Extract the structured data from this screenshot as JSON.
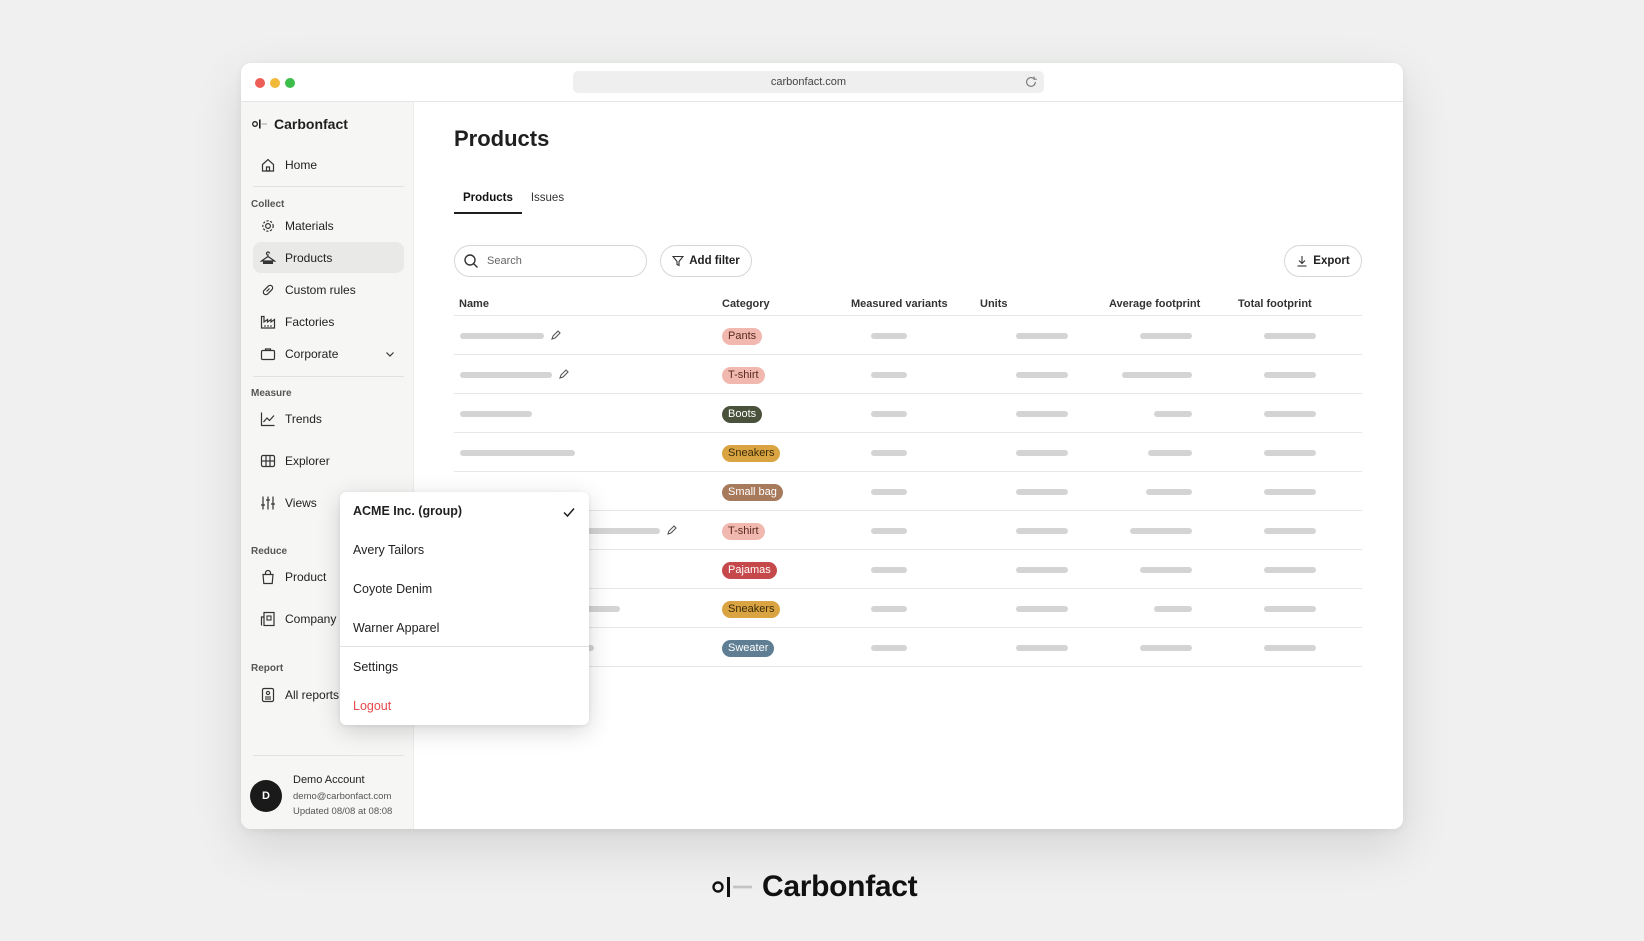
{
  "browser": {
    "url": "carbonfact.com"
  },
  "brand": {
    "name": "Carbonfact"
  },
  "sidebar": {
    "home": "Home",
    "sections": {
      "collect": "Collect",
      "measure": "Measure",
      "reduce": "Reduce",
      "report": "Report"
    },
    "collect_items": [
      "Materials",
      "Products",
      "Custom rules",
      "Factories",
      "Corporate"
    ],
    "measure_items": [
      "Trends",
      "Explorer",
      "Views"
    ],
    "reduce_items": [
      "Product",
      "Company"
    ],
    "report_items": [
      "All reports"
    ],
    "active_item": "Products"
  },
  "account": {
    "initial": "D",
    "name": "Demo Account",
    "email": "demo@carbonfact.com",
    "updated": "Updated 08/08 at 08:08"
  },
  "main": {
    "title": "Products",
    "tabs": [
      "Products",
      "Issues"
    ],
    "active_tab": "Products",
    "search_placeholder": "Search",
    "add_filter_label": "Add filter",
    "export_label": "Export"
  },
  "table": {
    "columns": [
      "Name",
      "Category",
      "Measured variants",
      "Units",
      "Average footprint",
      "Total footprint"
    ],
    "rows": [
      {
        "category": "Pants",
        "color": "#f0b8ae",
        "text_color": "#5a2a22"
      },
      {
        "category": "T-shirt",
        "color": "#f0b8ae",
        "text_color": "#5a2a22"
      },
      {
        "category": "Boots",
        "color": "#4b523c",
        "text_color": "#ffffff"
      },
      {
        "category": "Sneakers",
        "color": "#d9a441",
        "text_color": "#3a2a08"
      },
      {
        "category": "Small bag",
        "color": "#a87a5c",
        "text_color": "#ffffff"
      },
      {
        "category": "T-shirt",
        "color": "#f0b8ae",
        "text_color": "#5a2a22"
      },
      {
        "category": "Pajamas",
        "color": "#c5484a",
        "text_color": "#ffffff"
      },
      {
        "category": "Sneakers",
        "color": "#d9a441",
        "text_color": "#3a2a08"
      },
      {
        "category": "Sweater",
        "color": "#5f7e93",
        "text_color": "#ffffff"
      }
    ]
  },
  "dropdown": {
    "companies": [
      "ACME Inc. (group)",
      "Avery Tailors",
      "Coyote Denim",
      "Warner Apparel"
    ],
    "selected": "ACME Inc. (group)",
    "settings": "Settings",
    "logout": "Logout"
  },
  "footer": {
    "brand": "Carbonfact"
  },
  "colors": {
    "accent": "#1f1f1f",
    "logout": "#e5484d",
    "sidebar_bg": "#f6f6f5"
  }
}
